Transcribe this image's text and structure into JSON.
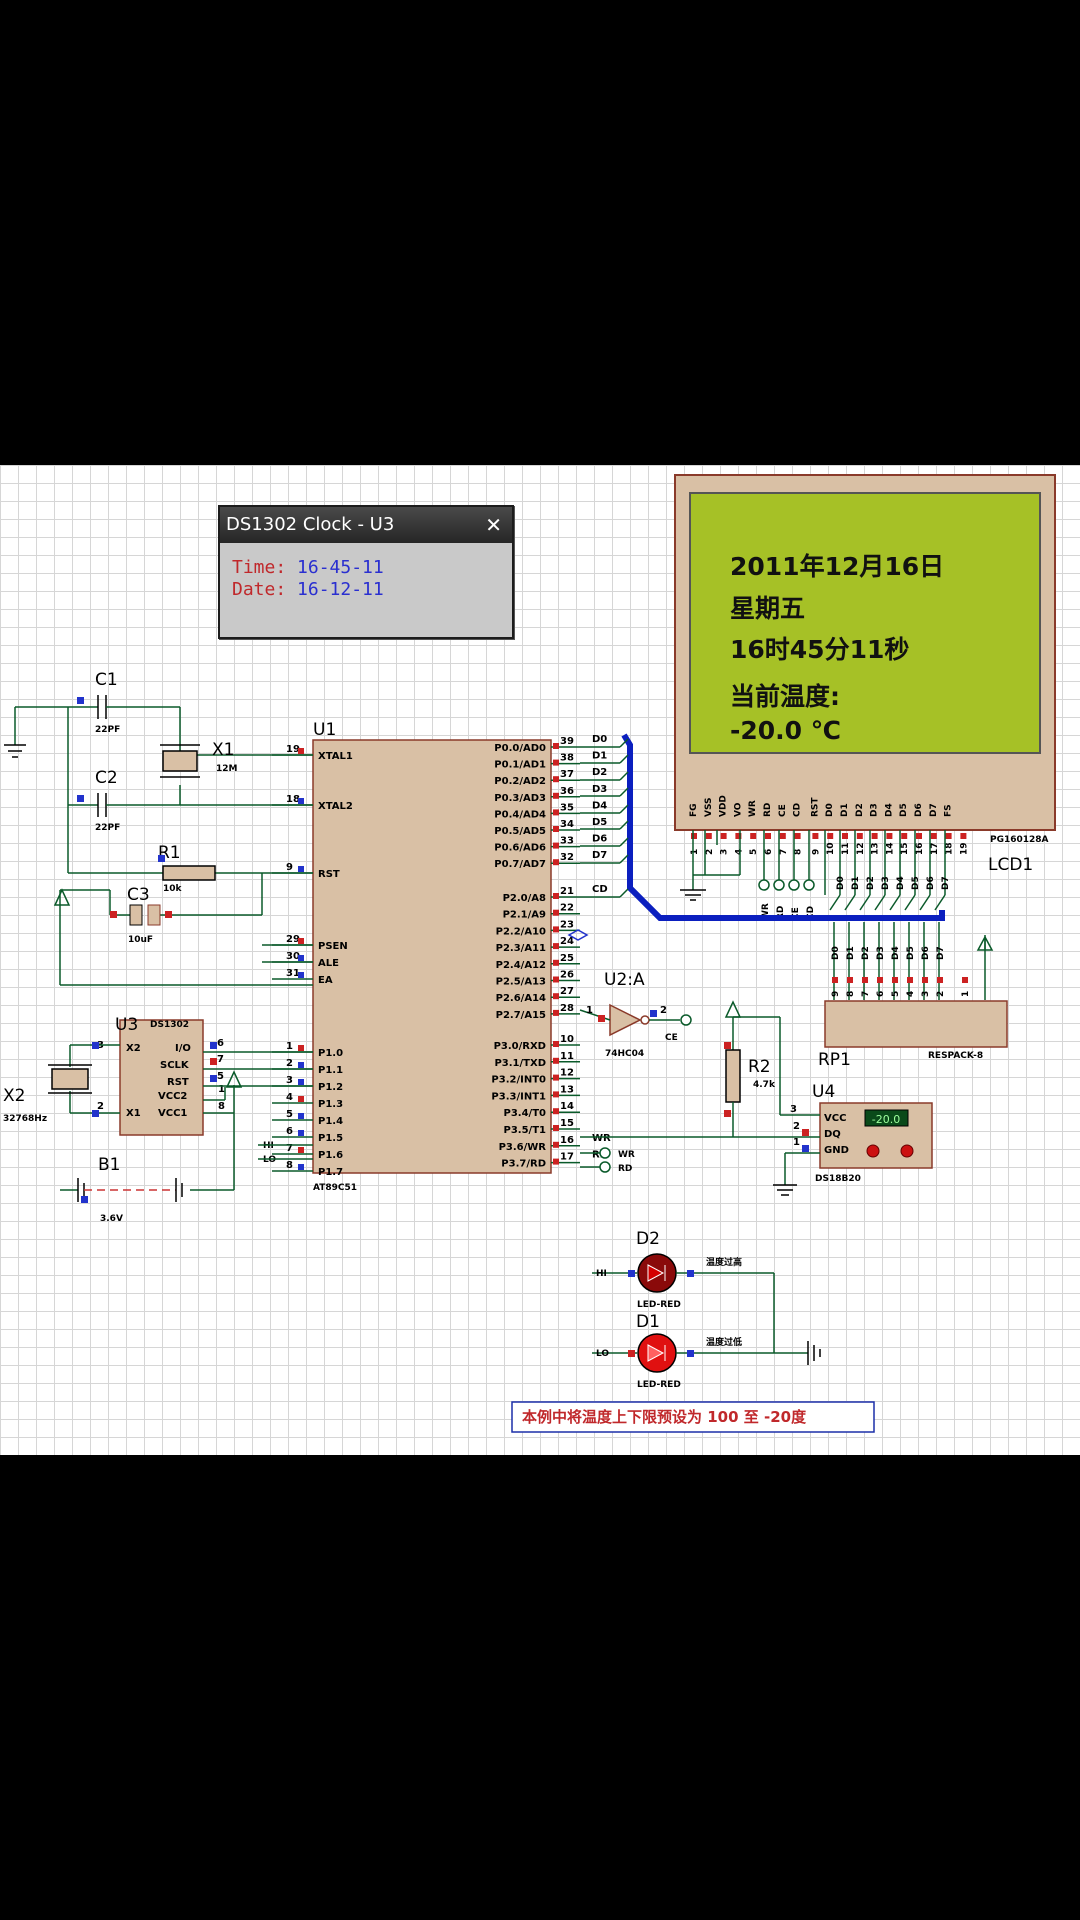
{
  "popup": {
    "title": "DS1302 Clock - U3",
    "close_glyph": "✕",
    "time_label": "Time:",
    "time_value": "16-45-11",
    "date_label": "Date:",
    "date_value": "16-12-11"
  },
  "lcd": {
    "line1": "2011年12月16日",
    "line2": "星期五",
    "line3": "16时45分11秒",
    "line4": "当前温度:",
    "line5": "-20.0 ℃",
    "ref": "LCD1",
    "model": "PG160128A",
    "pins": [
      "FG",
      "VSS",
      "VDD",
      "VO",
      "WR",
      "RD",
      "CE",
      "CD",
      "RST",
      "D0",
      "D1",
      "D2",
      "D3",
      "D4",
      "D5",
      "D6",
      "D7",
      "FS"
    ],
    "pin_numbers": [
      "1",
      "2",
      "3",
      "4",
      "5",
      "6",
      "7",
      "8",
      "9",
      "10",
      "11",
      "12",
      "13",
      "14",
      "15",
      "16",
      "17",
      "18",
      "19"
    ],
    "screen_color": "#a6c126"
  },
  "u1": {
    "ref": "U1",
    "model": "AT89C51",
    "left_pins": [
      {
        "num": "19",
        "name": "XTAL1"
      },
      {
        "num": "18",
        "name": "XTAL2"
      },
      {
        "num": "9",
        "name": "RST"
      },
      {
        "num": "29",
        "name": "PSEN"
      },
      {
        "num": "30",
        "name": "ALE"
      },
      {
        "num": "31",
        "name": "EA"
      },
      {
        "num": "1",
        "name": "P1.0"
      },
      {
        "num": "2",
        "name": "P1.1"
      },
      {
        "num": "3",
        "name": "P1.2"
      },
      {
        "num": "4",
        "name": "P1.3"
      },
      {
        "num": "5",
        "name": "P1.4"
      },
      {
        "num": "6",
        "name": "P1.5"
      },
      {
        "num": "7",
        "name": "P1.6"
      },
      {
        "num": "8",
        "name": "P1.7"
      }
    ],
    "right_pins": [
      {
        "num": "39",
        "name": "P0.0/AD0",
        "net": "D0"
      },
      {
        "num": "38",
        "name": "P0.1/AD1",
        "net": "D1"
      },
      {
        "num": "37",
        "name": "P0.2/AD2",
        "net": "D2"
      },
      {
        "num": "36",
        "name": "P0.3/AD3",
        "net": "D3"
      },
      {
        "num": "35",
        "name": "P0.4/AD4",
        "net": "D4"
      },
      {
        "num": "34",
        "name": "P0.5/AD5",
        "net": "D5"
      },
      {
        "num": "33",
        "name": "P0.6/AD6",
        "net": "D6"
      },
      {
        "num": "32",
        "name": "P0.7/AD7",
        "net": "D7"
      },
      {
        "num": "21",
        "name": "P2.0/A8",
        "net": "CD"
      },
      {
        "num": "22",
        "name": "P2.1/A9",
        "net": ""
      },
      {
        "num": "23",
        "name": "P2.2/A10",
        "net": ""
      },
      {
        "num": "24",
        "name": "P2.3/A11",
        "net": ""
      },
      {
        "num": "25",
        "name": "P2.4/A12",
        "net": ""
      },
      {
        "num": "26",
        "name": "P2.5/A13",
        "net": ""
      },
      {
        "num": "27",
        "name": "P2.6/A14",
        "net": ""
      },
      {
        "num": "28",
        "name": "P2.7/A15",
        "net": ""
      },
      {
        "num": "10",
        "name": "P3.0/RXD",
        "net": ""
      },
      {
        "num": "11",
        "name": "P3.1/TXD",
        "net": ""
      },
      {
        "num": "12",
        "name": "P3.2/INT0",
        "net": ""
      },
      {
        "num": "13",
        "name": "P3.3/INT1",
        "net": ""
      },
      {
        "num": "14",
        "name": "P3.4/T0",
        "net": ""
      },
      {
        "num": "15",
        "name": "P3.5/T1",
        "net": ""
      },
      {
        "num": "16",
        "name": "P3.6/WR",
        "net": "WR"
      },
      {
        "num": "17",
        "name": "P3.7/RD",
        "net": "RD"
      }
    ]
  },
  "components": {
    "c1": {
      "ref": "C1",
      "value": "22PF"
    },
    "c2": {
      "ref": "C2",
      "value": "22PF"
    },
    "x1": {
      "ref": "X1",
      "value": "12M"
    },
    "r1": {
      "ref": "R1",
      "value": "10k"
    },
    "c3": {
      "ref": "C3",
      "value": "10uF"
    },
    "u3": {
      "ref": "U3",
      "model": "DS1302",
      "pins": [
        {
          "num": "3",
          "name": "X2"
        },
        {
          "num": "6",
          "name": "I/O"
        },
        {
          "num": "7",
          "name": "SCLK"
        },
        {
          "num": "5",
          "name": "RST"
        },
        {
          "num": "2",
          "name": "X1"
        },
        {
          "num": "1",
          "name": "VCC2"
        },
        {
          "num": "8",
          "name": "VCC1"
        }
      ]
    },
    "x2": {
      "ref": "X2",
      "value": "32768Hz"
    },
    "b1": {
      "ref": "B1",
      "value": "3.6V"
    },
    "u2": {
      "ref": "U2:A",
      "model": "74HC04",
      "in": "1",
      "out": "2",
      "net": "CE"
    },
    "r2": {
      "ref": "R2",
      "value": "4.7k"
    },
    "u4": {
      "ref": "U4",
      "model": "DS18B20",
      "display": "-20.0",
      "pins": [
        {
          "num": "3",
          "name": "VCC"
        },
        {
          "num": "2",
          "name": "DQ"
        },
        {
          "num": "1",
          "name": "GND"
        }
      ]
    },
    "rp1": {
      "ref": "RP1",
      "model": "RESPACK-8",
      "pins": [
        "9",
        "8",
        "7",
        "6",
        "5",
        "4",
        "3",
        "2",
        "1"
      ],
      "nets": [
        "D0",
        "D1",
        "D2",
        "D3",
        "D4",
        "D5",
        "D6",
        "D7"
      ]
    },
    "d2": {
      "ref": "D2",
      "model": "LED-RED",
      "net": "HI",
      "note": "温度过高"
    },
    "d1": {
      "ref": "D1",
      "model": "LED-RED",
      "net": "LO",
      "note": "温度过低"
    },
    "p16_net": "HI",
    "p17_net": "LO",
    "lcd_ctrl_nets": [
      "WR",
      "RD",
      "CE",
      "CD"
    ]
  },
  "note": "本例中将温度上下限预设为 100 至 -20度"
}
